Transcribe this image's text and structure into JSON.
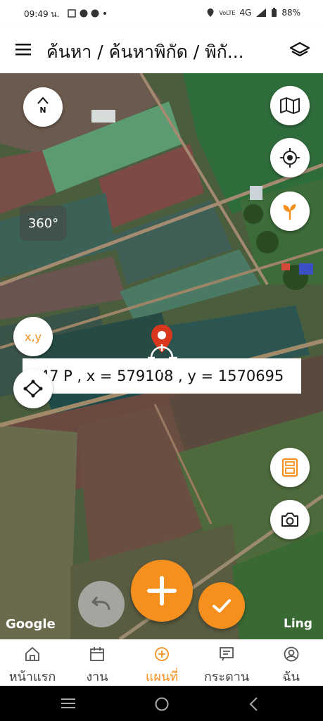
{
  "status_bar": {
    "time": "09:49 น.",
    "battery": "88%",
    "network": "4G"
  },
  "app_bar": {
    "title": "ค้นหา / ค้นหาพิกัด / พิกั..."
  },
  "map": {
    "compass_label": "N",
    "rotation": "360°",
    "coordinate_readout": "47 P , x = 579108 , y = 1570695",
    "xy_button": "x,y",
    "attribution_left": "Google",
    "attribution_right": "Ling"
  },
  "nav": [
    {
      "label": "หน้าแรก",
      "icon": "home-icon"
    },
    {
      "label": "งาน",
      "icon": "calendar-icon"
    },
    {
      "label": "แผนที่",
      "icon": "add-circle-icon"
    },
    {
      "label": "กระดาน",
      "icon": "board-icon"
    },
    {
      "label": "ฉัน",
      "icon": "user-icon"
    }
  ],
  "colors": {
    "accent": "#F5901E",
    "pin": "#D9361E"
  }
}
